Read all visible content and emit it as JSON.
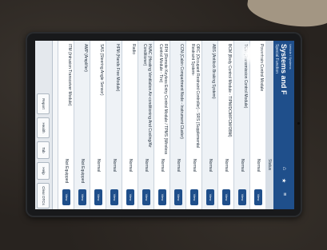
{
  "header": {
    "breadcrumb": "Vehicle / Systems",
    "title": "Systems and F",
    "subtitle": "Special Function"
  },
  "columns": {
    "status": "Status",
    "action": ""
  },
  "rows": [
    {
      "name": "Powertrain Control Module",
      "status": "Normal",
      "button": "View"
    },
    {
      "name": "TCM (Transmission Control Module)",
      "status": "Normal",
      "button": "View"
    },
    {
      "name": "BCM (Body Control Module - TIPM/DCM/FCM/OBM)",
      "status": "Normal",
      "button": "View"
    },
    {
      "name": "ABS (Antilock Braking System)",
      "status": "Normal",
      "button": "View"
    },
    {
      "name": "ORC (Occupant Restraint Controller) - SRS (Supplemental Restraint System-",
      "status": "Normal",
      "button": "View"
    },
    {
      "name": "CCN (Cabin Compartment Node - Instrument Cluster)",
      "status": "Normal",
      "button": "View"
    },
    {
      "name": "RFH (Remote Keyless Entry Control Module / TPMS (Wireless Control Module - Tire)",
      "status": "Normal",
      "button": "View"
    },
    {
      "name": "HVAC (Heating Ventilation Air-conditioning And Cooling/Air Conditioner)",
      "status": "Normal",
      "button": "View"
    },
    {
      "name": "Radio",
      "status": "Normal",
      "button": "View"
    },
    {
      "name": "HFM (Hands Free Module)",
      "status": "Normal",
      "button": "View"
    },
    {
      "name": "SAS (Steering Angle Sensor)",
      "status": "Normal",
      "button": "View"
    },
    {
      "name": "AMP (Amplifier)",
      "status": "Not Equipped",
      "button": "View"
    },
    {
      "name": "ITM (Intrusion Transceiver Module)",
      "status": "Not Equipped",
      "button": "View"
    }
  ],
  "bottombar": {
    "report": "Report",
    "health": "Health",
    "tab": "Tab",
    "help": "Help",
    "clear_dtc": "Clear DTCs"
  },
  "colors": {
    "accent": "#1f4f8b",
    "background": "#28231f"
  },
  "icons": [
    "home-icon",
    "star-icon",
    "menu-icon"
  ]
}
